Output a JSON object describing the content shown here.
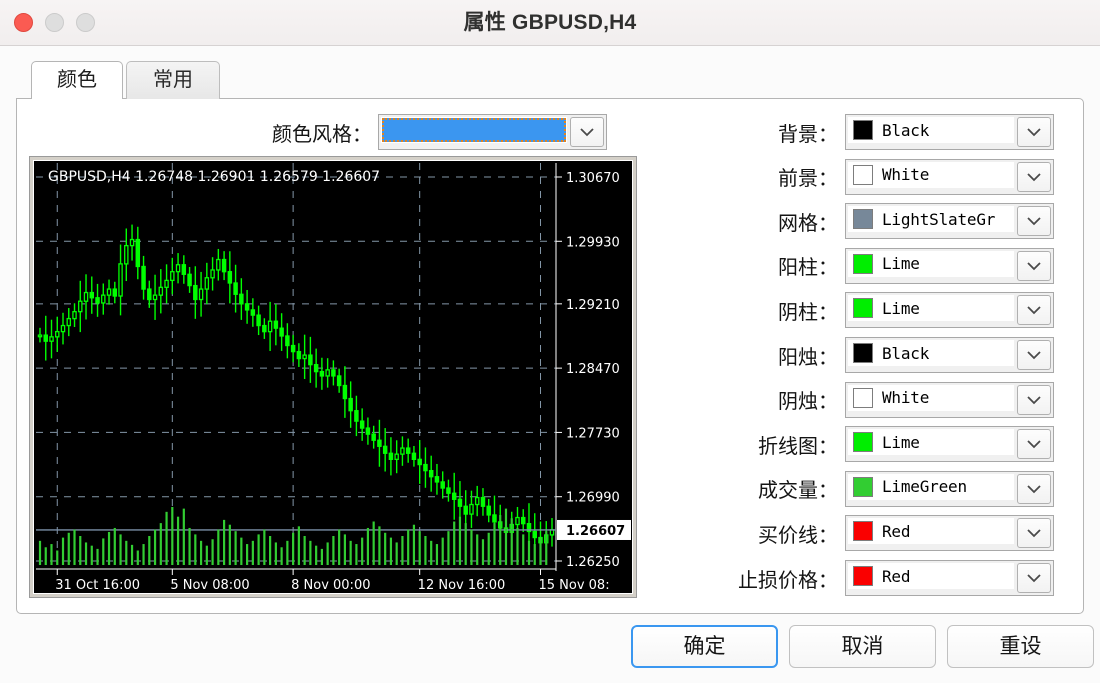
{
  "window": {
    "title": "属性 GBPUSD,H4",
    "traffic_lights": [
      "close-red",
      "minimize-gray",
      "zoom-gray"
    ]
  },
  "tabs": [
    {
      "label": "颜色",
      "active": true
    },
    {
      "label": "常用",
      "active": false
    }
  ],
  "color_scheme": {
    "label": "颜色风格：",
    "selected_value": "",
    "selection_color": "#3b96f0",
    "focus_outline_color": "#e38420",
    "arrow_icon": "chevron-down-icon"
  },
  "chart": {
    "header": "GBPUSD,H4  1.26748 1.26901 1.26579 1.26607",
    "symbol": "GBPUSD,H4",
    "ohlc": [
      "1.26748",
      "1.26901",
      "1.26579",
      "1.26607"
    ],
    "current_price": "1.26607",
    "background": "#000000",
    "grid_color": "#8497a8",
    "candle_color": "#00ff00",
    "volume_color": "#32cd32",
    "bid_line_color": "#7b8fa8"
  },
  "chart_data": {
    "type": "line",
    "title": "GBPUSD,H4",
    "xlabel": "",
    "ylabel": "",
    "ylim": [
      1.2625,
      1.3067
    ],
    "y_ticks": [
      "1.30670",
      "1.29930",
      "1.29210",
      "1.28470",
      "1.27730",
      "1.26990",
      "1.26250"
    ],
    "x_ticks": [
      "31 Oct 16:00",
      "5 Nov 08:00",
      "8 Nov 00:00",
      "12 Nov 16:00",
      "15 Nov 08:"
    ],
    "current_price_label": "1.26607",
    "grid": true,
    "legend": "none",
    "ohlc_labels": [
      "1.26748",
      "1.26901",
      "1.26579",
      "1.26607"
    ],
    "series": [
      {
        "name": "close",
        "values": [
          1.2885,
          1.2878,
          1.2883,
          1.2889,
          1.2896,
          1.2904,
          1.2912,
          1.2924,
          1.2934,
          1.2928,
          1.2922,
          1.2931,
          1.2938,
          1.293,
          1.2967,
          1.2988,
          1.2995,
          1.2964,
          1.2938,
          1.2926,
          1.2931,
          1.294,
          1.2948,
          1.2958,
          1.2966,
          1.2955,
          1.2942,
          1.2926,
          1.2938,
          1.2951,
          1.296,
          1.2972,
          1.2958,
          1.2945,
          1.2932,
          1.2921,
          1.2914,
          1.2908,
          1.2896,
          1.2889,
          1.2901,
          1.2893,
          1.2884,
          1.2873,
          1.2866,
          1.2858,
          1.2862,
          1.2851,
          1.2843,
          1.2838,
          1.2845,
          1.2838,
          1.2827,
          1.2812,
          1.2798,
          1.2786,
          1.2778,
          1.2771,
          1.2764,
          1.2757,
          1.2749,
          1.2742,
          1.2748,
          1.2755,
          1.2749,
          1.2742,
          1.2736,
          1.2729,
          1.2722,
          1.2716,
          1.2709,
          1.2703,
          1.2696,
          1.2688,
          1.2679,
          1.269,
          1.2698,
          1.2688,
          1.2678,
          1.267,
          1.2663,
          1.2658,
          1.2667,
          1.2675,
          1.2668,
          1.2659,
          1.2652,
          1.2646,
          1.2655,
          1.2661
        ]
      },
      {
        "name": "volume",
        "values": [
          30,
          22,
          26,
          18,
          34,
          40,
          44,
          36,
          28,
          24,
          20,
          33,
          41,
          46,
          38,
          30,
          25,
          18,
          26,
          36,
          44,
          52,
          66,
          72,
          60,
          70,
          46,
          38,
          30,
          24,
          32,
          44,
          56,
          50,
          42,
          34,
          26,
          30,
          38,
          44,
          36,
          28,
          22,
          30,
          40,
          48,
          36,
          30,
          24,
          20,
          28,
          36,
          44,
          38,
          30,
          26,
          34,
          46,
          54,
          48,
          40,
          34,
          28,
          36,
          44,
          50,
          42,
          36,
          30,
          26,
          34,
          42,
          54,
          60,
          52,
          44,
          38,
          32,
          40,
          52,
          62,
          70,
          58,
          46,
          38,
          30,
          26,
          34,
          42
        ]
      }
    ]
  },
  "color_rows": [
    {
      "label": "背景：",
      "value": "Black",
      "swatch": "#000000",
      "arrow_icon": "chevron-down-icon"
    },
    {
      "label": "前景：",
      "value": "White",
      "swatch": "#ffffff",
      "arrow_icon": "chevron-down-icon"
    },
    {
      "label": "网格：",
      "value": "LightSlateGr",
      "swatch": "#778899",
      "arrow_icon": "chevron-down-icon"
    },
    {
      "label": "阳柱：",
      "value": "Lime",
      "swatch": "#00ee00",
      "arrow_icon": "chevron-down-icon"
    },
    {
      "label": "阴柱：",
      "value": "Lime",
      "swatch": "#00ee00",
      "arrow_icon": "chevron-down-icon"
    },
    {
      "label": "阳烛：",
      "value": "Black",
      "swatch": "#000000",
      "arrow_icon": "chevron-down-icon"
    },
    {
      "label": "阴烛：",
      "value": "White",
      "swatch": "#ffffff",
      "arrow_icon": "chevron-down-icon"
    },
    {
      "label": "折线图：",
      "value": "Lime",
      "swatch": "#00ee00",
      "arrow_icon": "chevron-down-icon"
    },
    {
      "label": "成交量：",
      "value": "LimeGreen",
      "swatch": "#32cd32",
      "arrow_icon": "chevron-down-icon"
    },
    {
      "label": "买价线：",
      "value": "Red",
      "swatch": "#fa0000",
      "arrow_icon": "chevron-down-icon"
    },
    {
      "label": "止损价格：",
      "value": "Red",
      "swatch": "#fa0000",
      "arrow_icon": "chevron-down-icon"
    }
  ],
  "footer": {
    "ok_label": "确定",
    "cancel_label": "取消",
    "reset_label": "重设"
  }
}
